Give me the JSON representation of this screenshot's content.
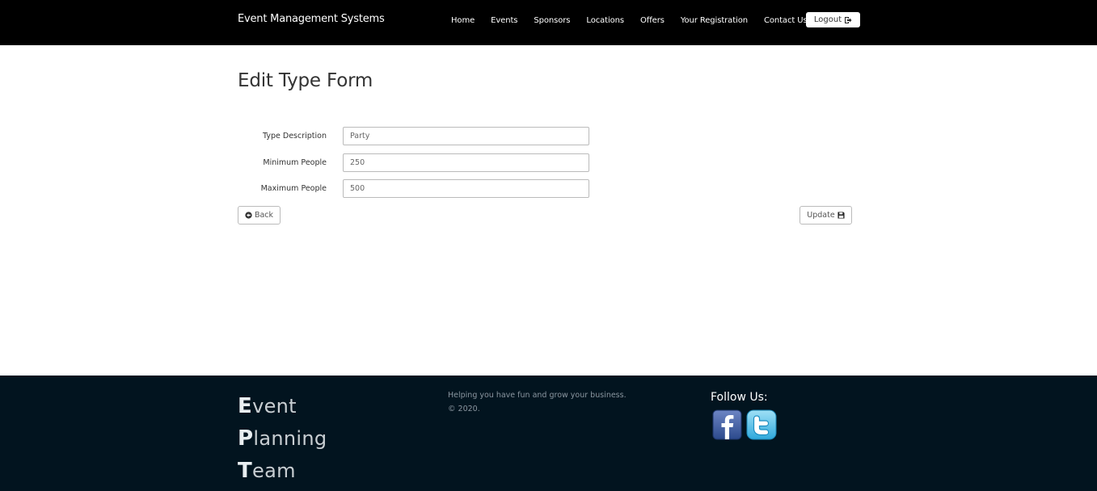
{
  "navbar": {
    "brand": "Event Management Systems",
    "links": [
      "Home",
      "Events",
      "Sponsors",
      "Locations",
      "Offers",
      "Your Registration",
      "Contact Us"
    ],
    "logout_label": "Logout"
  },
  "page": {
    "title": "Edit Type Form"
  },
  "form": {
    "type_description": {
      "label": "Type Description",
      "value": "Party"
    },
    "minimum_people": {
      "label": "Minimum People",
      "value": "250"
    },
    "maximum_people": {
      "label": "Maximum People",
      "value": "500"
    },
    "back_label": "Back",
    "update_label": "Update"
  },
  "footer": {
    "logo_lines": [
      {
        "initial": "E",
        "rest": "vent"
      },
      {
        "initial": "P",
        "rest": "lanning"
      },
      {
        "initial": "T",
        "rest": "eam"
      }
    ],
    "tagline": "Helping you have fun and grow your business.",
    "copyright": "© 2020.",
    "follow_label": "Follow Us:",
    "social_icons": [
      "facebook-icon",
      "twitter-icon"
    ]
  },
  "colors": {
    "navbar_bg": "#000000",
    "footer_bg": "#02141f"
  }
}
